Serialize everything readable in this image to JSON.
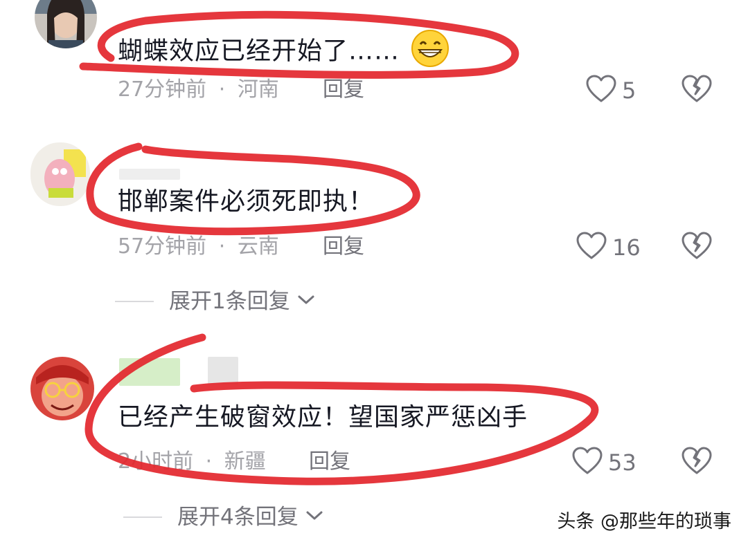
{
  "comments": [
    {
      "text": "蝴蝶效应已经开始了……",
      "emoji": "grinning-face-icon",
      "time": "27分钟前",
      "location": "河南",
      "reply_label": "回复",
      "likes": "5"
    },
    {
      "text": "邯郸案件必须死即执！",
      "time": "57分钟前",
      "location": "云南",
      "reply_label": "回复",
      "likes": "16",
      "expand_label": "展开1条回复"
    },
    {
      "text": "已经产生破窗效应！望国家严惩凶手",
      "time": "2小时前",
      "location": "新疆",
      "reply_label": "回复",
      "likes": "53",
      "expand_label": "展开4条回复"
    }
  ],
  "separator": "·",
  "watermark": "头条 @那些年的琐事",
  "colors": {
    "text": "#161823",
    "meta": "#a3a3a8",
    "action": "#73737a",
    "annotation_red": "#e3262c",
    "name_green": "#d6eec8"
  }
}
